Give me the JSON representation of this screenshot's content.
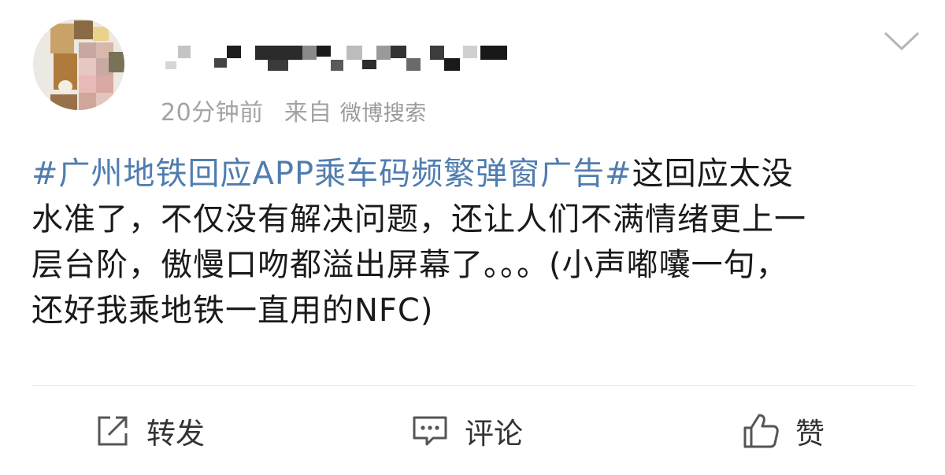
{
  "post": {
    "username_display": "pixelated",
    "time": "20分钟前",
    "source": "来自",
    "source_app": "微博搜索",
    "topic": "#广州地铁回应APP乘车码频繁弹窗广告#",
    "line1_rest": "这回应太没",
    "line2": "水准了，不仅没有解决问题，还让人们不满情绪更上一",
    "line3": "层台阶，傲慢口吻都溢出屏幕了。。。(小声嘟囔一句，",
    "line4": "还好我乘地铁一直用的NFC)"
  },
  "actions": {
    "repost_label": "转发",
    "comment_label": "评论",
    "like_label": "赞"
  },
  "colors": {
    "topic": "#507daf",
    "meta": "#a3a3a3",
    "icon": "#555555"
  },
  "icons": {
    "repost": "share-box-icon",
    "comment": "speech-bubble-icon",
    "like": "thumbs-up-icon",
    "menu": "chevron-down-icon"
  }
}
